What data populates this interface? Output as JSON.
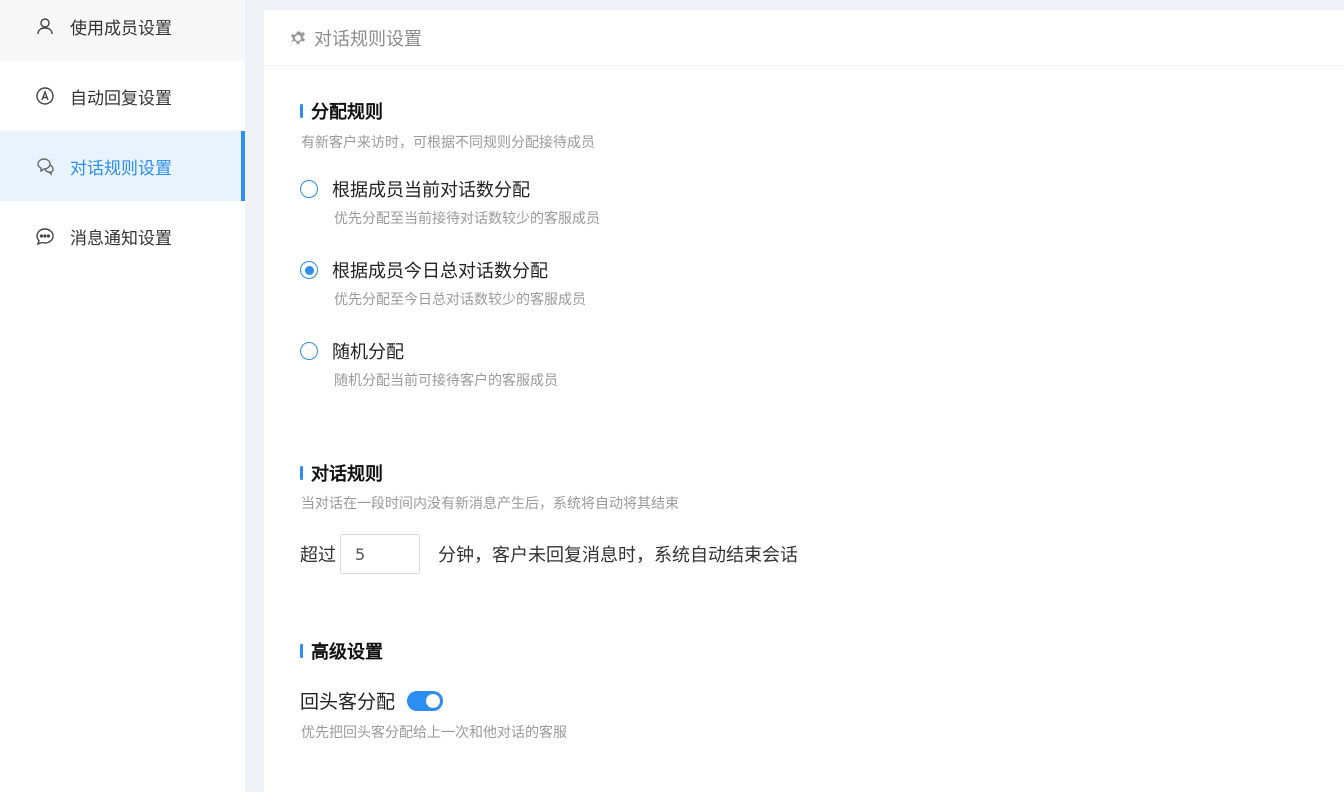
{
  "sidebar": {
    "items": [
      {
        "label": "使用成员设置",
        "icon": "user-icon"
      },
      {
        "label": "自动回复设置",
        "icon": "auto-reply-icon"
      },
      {
        "label": "对话规则设置",
        "icon": "chat-bubbles-icon",
        "active": true
      },
      {
        "label": "消息通知设置",
        "icon": "message-dots-icon"
      }
    ]
  },
  "header": {
    "title": "对话规则设置",
    "icon": "gear-icon"
  },
  "allocation": {
    "title": "分配规则",
    "desc": "有新客户来访时，可根据不同规则分配接待成员",
    "options": [
      {
        "label": "根据成员当前对话数分配",
        "desc": "优先分配至当前接待对话数较少的客服成员",
        "selected": false
      },
      {
        "label": "根据成员今日总对话数分配",
        "desc": "优先分配至今日总对话数较少的客服成员",
        "selected": true
      },
      {
        "label": "随机分配",
        "desc": "随机分配当前可接待客户的客服成员",
        "selected": false
      }
    ]
  },
  "conversation": {
    "title": "对话规则",
    "desc": "当对话在一段时间内没有新消息产生后，系统将自动将其结束",
    "prefix": "超过",
    "minutes": "5",
    "suffix": "分钟，客户未回复消息时，系统自动结束会话"
  },
  "advanced": {
    "title": "高级设置",
    "returning_label": "回头客分配",
    "returning_enabled": true,
    "returning_desc": "优先把回头客分配给上一次和他对话的客服"
  },
  "colors": {
    "accent": "#2b8ef0",
    "muted": "#999999"
  }
}
